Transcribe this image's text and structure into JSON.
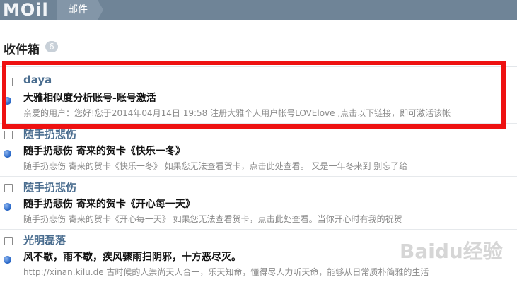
{
  "app": {
    "logo": "MOil",
    "breadcrumb": "邮件"
  },
  "inbox": {
    "title": "收件箱",
    "count": "6"
  },
  "messages": [
    {
      "sender": "daya",
      "subject": "大雅相似度分析账号-账号激活",
      "snippet": "亲爱的用户：您好!您于2014年04月14日 19:58 注册大雅个人用户帐号LOVElove ,点击以下链接，即可激活该帐"
    },
    {
      "sender": "随手扔悲伤",
      "subject": "随手扔悲伤 寄来的贺卡《快乐一冬》",
      "snippet": "随手扔悲伤 寄来的贺卡《快乐一冬》       如果您无法查看贺卡，点击此处查看。 又是一年冬来到 别忘了给"
    },
    {
      "sender": "随手扔悲伤",
      "subject": "随手扔悲伤 寄来的贺卡《开心每一天》",
      "snippet": "随手扔悲伤 寄来的贺卡《开心每一天》       如果您无法查看贺卡，点击此处查看。当你开心时有我的祝贺"
    },
    {
      "sender": "光明磊落",
      "subject": "风不歇，雨不歇，疾风骤雨扫阴邪，十方恶尽灭。",
      "snippet": "http://xinan.kilu.de  古时候的人崇尚天人合一，乐天知命，懂得尽人力听天命，能够从日常质朴简雅的生活"
    }
  ],
  "watermark": "Baidu经验",
  "colors": {
    "topbar": "#6f8497",
    "highlight": "#ee1111",
    "sender": "#4a6d8f",
    "unread_dot": "#2e6ccb"
  }
}
